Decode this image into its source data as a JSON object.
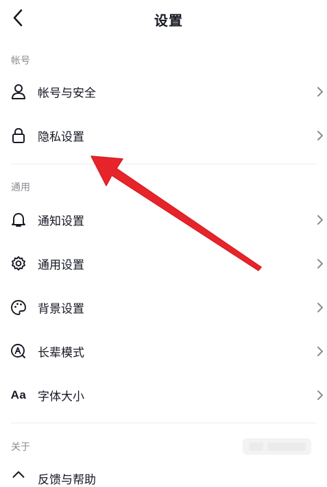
{
  "header": {
    "title": "设置",
    "back_icon": "chevron-left-icon"
  },
  "sections": {
    "account": {
      "header": "帐号",
      "items": [
        {
          "label": "帐号与安全",
          "icon": "person-icon"
        },
        {
          "label": "隐私设置",
          "icon": "lock-icon"
        }
      ]
    },
    "general": {
      "header": "通用",
      "items": [
        {
          "label": "通知设置",
          "icon": "bell-icon"
        },
        {
          "label": "通用设置",
          "icon": "gear-icon"
        },
        {
          "label": "背景设置",
          "icon": "palette-icon"
        },
        {
          "label": "长辈模式",
          "icon": "elder-mode-icon"
        },
        {
          "label": "字体大小",
          "icon": "font-size-icon",
          "icon_text": "Aa"
        }
      ]
    },
    "about": {
      "header": "关于",
      "items": [
        {
          "label": "反馈与帮助",
          "icon": "help-icon"
        }
      ]
    }
  },
  "annotation": {
    "arrow_color": "#e8242b",
    "points_to": "隐私设置"
  },
  "colors": {
    "text": "#161823",
    "section_header": "#8a8b91",
    "chevron": "#8a8b91",
    "divider": "#ececec"
  }
}
